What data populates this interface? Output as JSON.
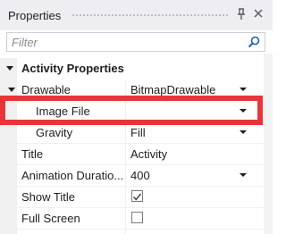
{
  "panel": {
    "title": "Properties",
    "pin_icon": "pin-icon",
    "close_icon": "close-icon"
  },
  "filter": {
    "placeholder": "Filter",
    "value": "",
    "icon": "search-icon"
  },
  "category": {
    "label": "Activity Properties",
    "expanded": true
  },
  "rows": [
    {
      "name": "Drawable",
      "value": "BitmapDrawable",
      "control": "dropdown",
      "expandable": true
    },
    {
      "name": "Image File",
      "value": "",
      "control": "dropdown",
      "nested": true,
      "highlighted": true
    },
    {
      "name": "Gravity",
      "value": "Fill",
      "control": "dropdown",
      "nested": true
    },
    {
      "name": "Title",
      "value": "Activity",
      "control": "text"
    },
    {
      "name": "Animation Duratio...",
      "value": "400",
      "control": "dropdown"
    },
    {
      "name": "Show Title",
      "checked": true,
      "control": "checkbox"
    },
    {
      "name": "Full Screen",
      "checked": false,
      "control": "checkbox"
    }
  ],
  "colors": {
    "highlight": "#e8343b",
    "titlebar": "#eeeef2"
  }
}
